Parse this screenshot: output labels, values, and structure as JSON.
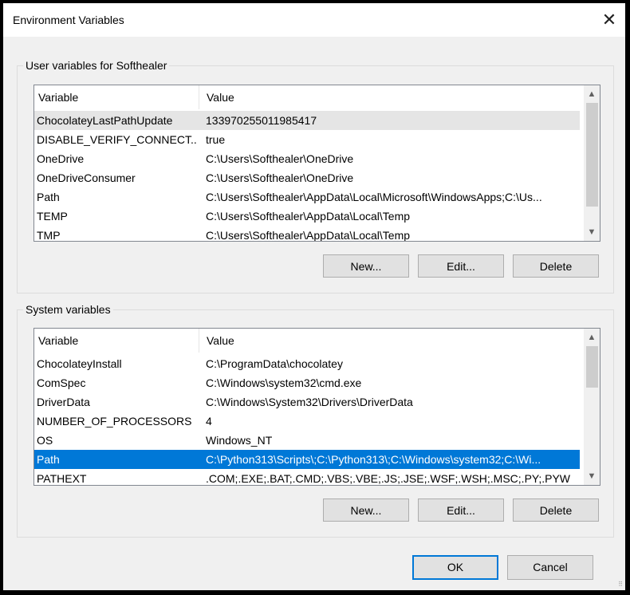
{
  "window": {
    "title": "Environment Variables",
    "close_glyph": "✕"
  },
  "user_section": {
    "label": "User variables for Softhealer",
    "columns": [
      "Variable",
      "Value"
    ],
    "rows": [
      {
        "variable": "ChocolateyLastPathUpdate",
        "value": "133970255011985417"
      },
      {
        "variable": "DISABLE_VERIFY_CONNECT...",
        "value": "true"
      },
      {
        "variable": "OneDrive",
        "value": "C:\\Users\\Softhealer\\OneDrive"
      },
      {
        "variable": "OneDriveConsumer",
        "value": "C:\\Users\\Softhealer\\OneDrive"
      },
      {
        "variable": "Path",
        "value": "C:\\Users\\Softhealer\\AppData\\Local\\Microsoft\\WindowsApps;C:\\Us..."
      },
      {
        "variable": "TEMP",
        "value": "C:\\Users\\Softhealer\\AppData\\Local\\Temp"
      },
      {
        "variable": "TMP",
        "value": "C:\\Users\\Softhealer\\AppData\\Local\\Temp"
      }
    ],
    "buttons": {
      "new": "New...",
      "edit": "Edit...",
      "delete": "Delete"
    }
  },
  "system_section": {
    "label": "System variables",
    "columns": [
      "Variable",
      "Value"
    ],
    "rows": [
      {
        "variable": "ChocolateyInstall",
        "value": "C:\\ProgramData\\chocolatey"
      },
      {
        "variable": "ComSpec",
        "value": "C:\\Windows\\system32\\cmd.exe"
      },
      {
        "variable": "DriverData",
        "value": "C:\\Windows\\System32\\Drivers\\DriverData"
      },
      {
        "variable": "NUMBER_OF_PROCESSORS",
        "value": "4"
      },
      {
        "variable": "OS",
        "value": "Windows_NT"
      },
      {
        "variable": "Path",
        "value": "C:\\Python313\\Scripts\\;C:\\Python313\\;C:\\Windows\\system32;C:\\Wi..."
      },
      {
        "variable": "PATHEXT",
        "value": ".COM;.EXE;.BAT;.CMD;.VBS;.VBE;.JS;.JSE;.WSF;.WSH;.MSC;.PY;.PYW"
      }
    ],
    "selected_row": "Path",
    "buttons": {
      "new": "New...",
      "edit": "Edit...",
      "delete": "Delete"
    }
  },
  "footer": {
    "ok": "OK",
    "cancel": "Cancel"
  },
  "colors": {
    "selection": "#0078d7",
    "hover_row": "#e5e5e5",
    "default_button_border": "#0078d7"
  },
  "icons": {
    "close": "close-icon",
    "scroll_up": "chevron-up-icon",
    "scroll_down": "chevron-down-icon",
    "resize": "resize-grip-icon"
  }
}
